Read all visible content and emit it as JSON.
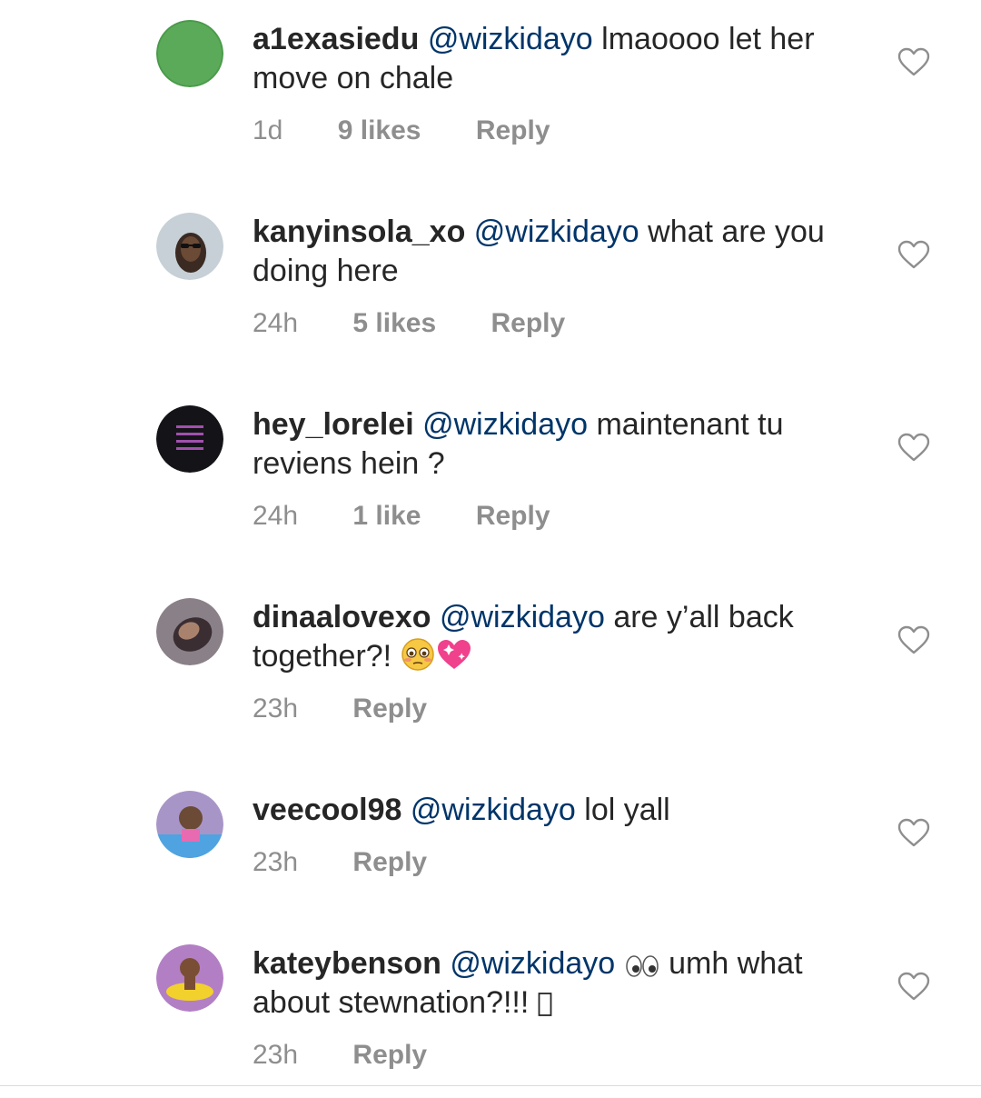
{
  "comments": [
    {
      "username": "a1exasiedu",
      "mention": "@wizkidayo",
      "text": " lmaoooo let her move on chale",
      "time": "1d",
      "likes": "9 likes",
      "reply": "Reply",
      "avatar_color": "#5aaa5a"
    },
    {
      "username": "kanyinsola_xo",
      "mention": "@wizkidayo",
      "text": " what are you doing here",
      "time": "24h",
      "likes": "5 likes",
      "reply": "Reply",
      "avatar_color": "#b9c4cc"
    },
    {
      "username": "hey_lorelei",
      "mention": "@wizkidayo",
      "text": " maintenant tu reviens hein ?",
      "time": "24h",
      "likes": "1 like",
      "reply": "Reply",
      "avatar_color": "#141418"
    },
    {
      "username": "dinaalovexo",
      "mention": "@wizkidayo",
      "text": " are y’all back together?! ",
      "time": "23h",
      "reply": "Reply",
      "avatar_color": "#6a5f66"
    },
    {
      "username": "veecool98",
      "mention": "@wizkidayo",
      "text": " lol yall",
      "time": "23h",
      "reply": "Reply",
      "avatar_color": "#a895c8"
    },
    {
      "username": "kateybenson",
      "mention": "@wizkidayo",
      "text_before": " ",
      "text_after": " umh what about stewnation?!!! ",
      "time": "23h",
      "reply": "Reply",
      "avatar_color": "#b37fc4"
    }
  ],
  "icons": {
    "heart": "heart-outline-icon",
    "flushed": "flushed-face-emoji",
    "sparkling_heart": "sparkling-heart-emoji",
    "eyes": "eyes-emoji",
    "missing_glyph": "missing-glyph"
  },
  "colors": {
    "text": "#262626",
    "mention": "#003569",
    "meta": "#8e8e8e"
  }
}
